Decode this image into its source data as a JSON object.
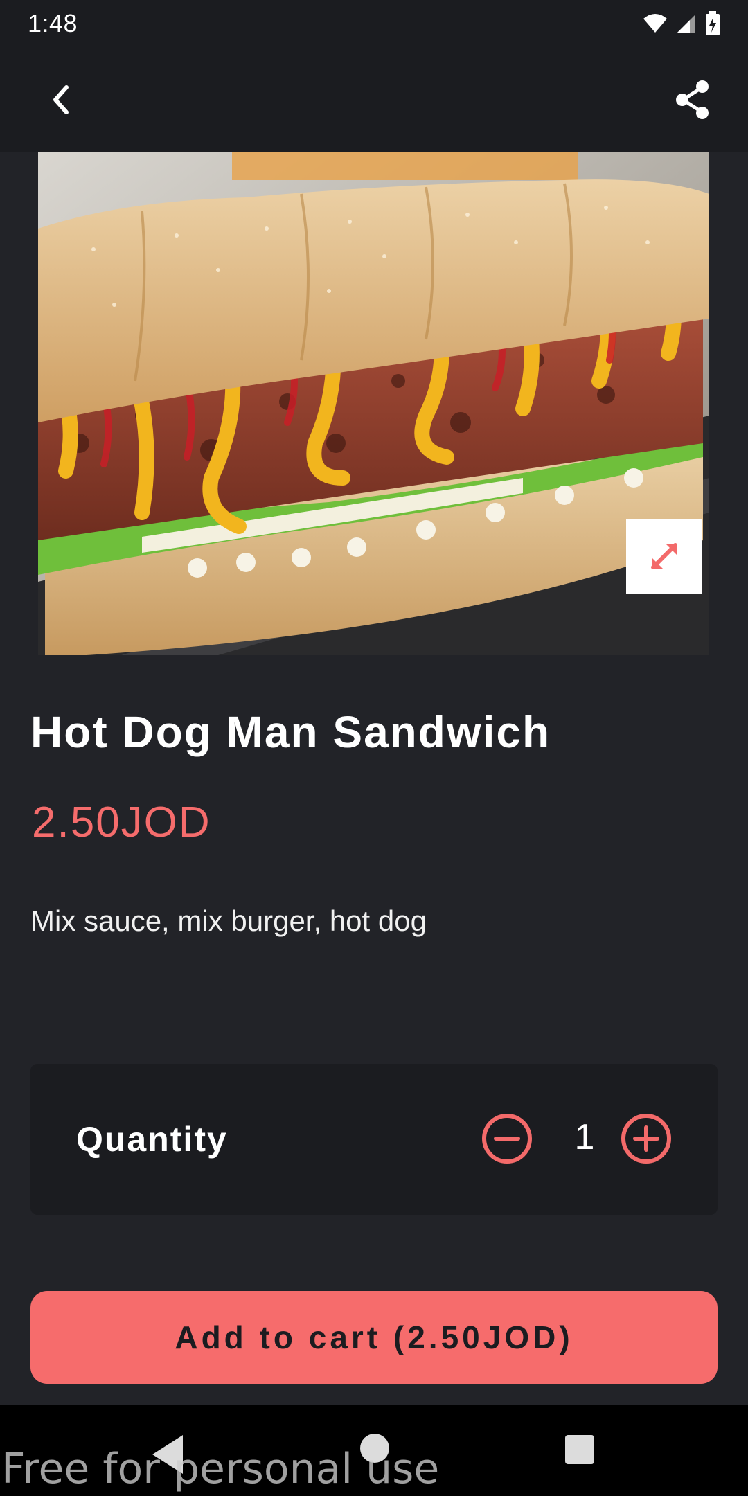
{
  "status_bar": {
    "time": "1:48",
    "icons": [
      "wifi-icon",
      "signal-icon",
      "battery-charging-icon"
    ]
  },
  "app_bar": {
    "back_icon": "chevron-left-icon",
    "share_icon": "share-icon"
  },
  "hero": {
    "image": "hot-dog-sandwich-photo",
    "expand_icon": "expand-arrows-icon"
  },
  "product": {
    "title": "Hot Dog Man Sandwich",
    "price": "2.50JOD",
    "description": "Mix sauce, mix burger, hot dog"
  },
  "quantity": {
    "label": "Quantity",
    "value": "1",
    "minus_icon": "minus-circle-icon",
    "plus_icon": "plus-circle-icon"
  },
  "cart": {
    "label": "Add to cart (2.50JOD)"
  },
  "nav": {
    "back_icon": "nav-back-icon",
    "home_icon": "nav-home-icon",
    "recent_icon": "nav-recents-icon"
  },
  "watermark": "Free for personal use",
  "colors": {
    "accent": "#f66c6c",
    "background": "#222328",
    "bar": "#1b1c20"
  }
}
